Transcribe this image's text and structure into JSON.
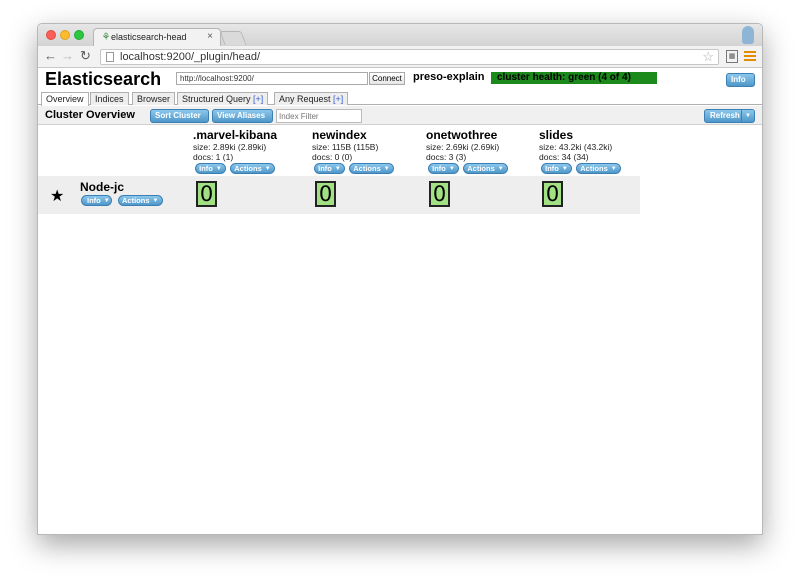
{
  "browser": {
    "tab_title": "elasticsearch-head",
    "tab_close": "×",
    "url": "localhost:9200/_plugin/head/"
  },
  "header": {
    "app_title": "Elasticsearch",
    "connection_url": "http://localhost:9200/",
    "connect_label": "Connect",
    "cluster_name": "preso-explain",
    "cluster_health": "cluster health: green (4 of 4)",
    "health_color": "#1b8a1b",
    "info_label": "Info"
  },
  "tabs": [
    {
      "label": "Overview",
      "plus": ""
    },
    {
      "label": "Indices",
      "plus": ""
    },
    {
      "label": "Browser",
      "plus": ""
    },
    {
      "label": "Structured Query ",
      "plus": "[+]"
    },
    {
      "label": "Any Request ",
      "plus": "[+]"
    }
  ],
  "overview": {
    "title": "Cluster Overview",
    "sort_label": "Sort Cluster",
    "aliases_label": "View Aliases",
    "filter_placeholder": "Index Filter",
    "refresh_label": "Refresh"
  },
  "indices": [
    {
      "name": ".marvel-kibana",
      "size": "size: 2.89ki (2.89ki)",
      "docs": "docs: 1 (1)",
      "shard": "0"
    },
    {
      "name": "newindex",
      "size": "size: 115B (115B)",
      "docs": "docs: 0 (0)",
      "shard": "0"
    },
    {
      "name": "onetwothree",
      "size": "size: 2.69ki (2.69ki)",
      "docs": "docs: 3 (3)",
      "shard": "0"
    },
    {
      "name": "slides",
      "size": "size: 43.2ki (43.2ki)",
      "docs": "docs: 34 (34)",
      "shard": "0"
    }
  ],
  "mini_buttons": {
    "info": "Info",
    "actions": "Actions"
  },
  "node": {
    "name": "Node-jc",
    "info_label": "Info",
    "actions_label": "Actions"
  },
  "colors": {
    "accent": "#4f97c9",
    "shard": "#a1e184"
  }
}
